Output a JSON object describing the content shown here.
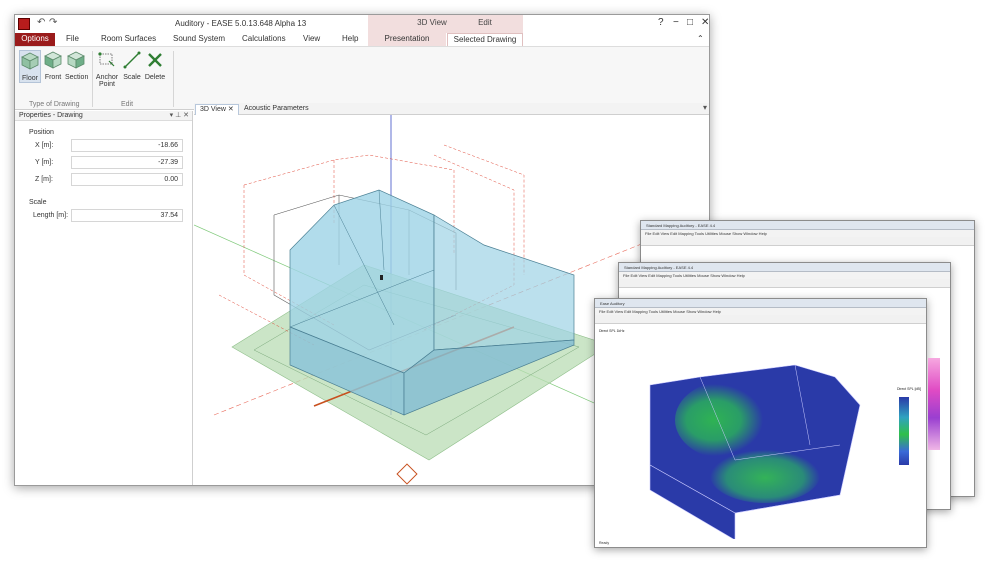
{
  "main_window": {
    "title": "Auditory - EASE 5.0.13.648 Alpha 13",
    "context_group_3d": "3D View",
    "context_group_edit": "Edit",
    "tabs": [
      "File",
      "Room Surfaces",
      "Sound System",
      "Calculations",
      "View",
      "Help"
    ],
    "options_tab": "Options",
    "context_tab_presentation": "Presentation",
    "context_tab_selected_drawing": "Selected Drawing",
    "ribbon": {
      "buttons": [
        {
          "label": "Floor",
          "icon": "floor-cube-icon"
        },
        {
          "label": "Front",
          "icon": "front-cube-icon"
        },
        {
          "label": "Section",
          "icon": "section-cube-icon"
        },
        {
          "label": "Anchor Point",
          "icon": "anchor-point-icon"
        },
        {
          "label": "Scale",
          "icon": "scale-icon"
        },
        {
          "label": "Delete",
          "icon": "delete-x-icon"
        }
      ],
      "group_type_of_drawing": "Type of Drawing",
      "group_edit": "Edit"
    },
    "properties_panel": {
      "title": "Properties - Drawing",
      "position_label": "Position",
      "scale_label": "Scale",
      "fields": [
        {
          "label": "X [m]:",
          "value": "-18.66"
        },
        {
          "label": "Y [m]:",
          "value": "-27.39"
        },
        {
          "label": "Z [m]:",
          "value": "0.00"
        }
      ],
      "length_label": "Length [m]:",
      "length_value": "37.54"
    },
    "doc_tabs": [
      "3D View",
      "Acoustic Parameters"
    ]
  },
  "mapping_windows": {
    "back_title": "Standard Mapping Auditory - EASE 4.4",
    "middle_title": "Standard Mapping Auditory - EASE 4.4",
    "front_title": "Ease Auditory",
    "menu_items": "File   Edit   View   Edit   Mapping   Tools   Utilities   Mouse   Show   Window   Help",
    "info_text": "Direct SPL 1kHz",
    "legend_label": "Direct SPL [dB]",
    "status_text": "Ready"
  },
  "colors": {
    "options_red": "#9a1b1b",
    "context_pink": "#f2dede",
    "room_blue": "#9ed3e6",
    "floor_green": "#b9dcb4",
    "dim_red": "#e04b3a",
    "axis_blue": "#3b4fc6",
    "map_blue": "#2a3aa8",
    "map_green": "#2fc04a"
  }
}
